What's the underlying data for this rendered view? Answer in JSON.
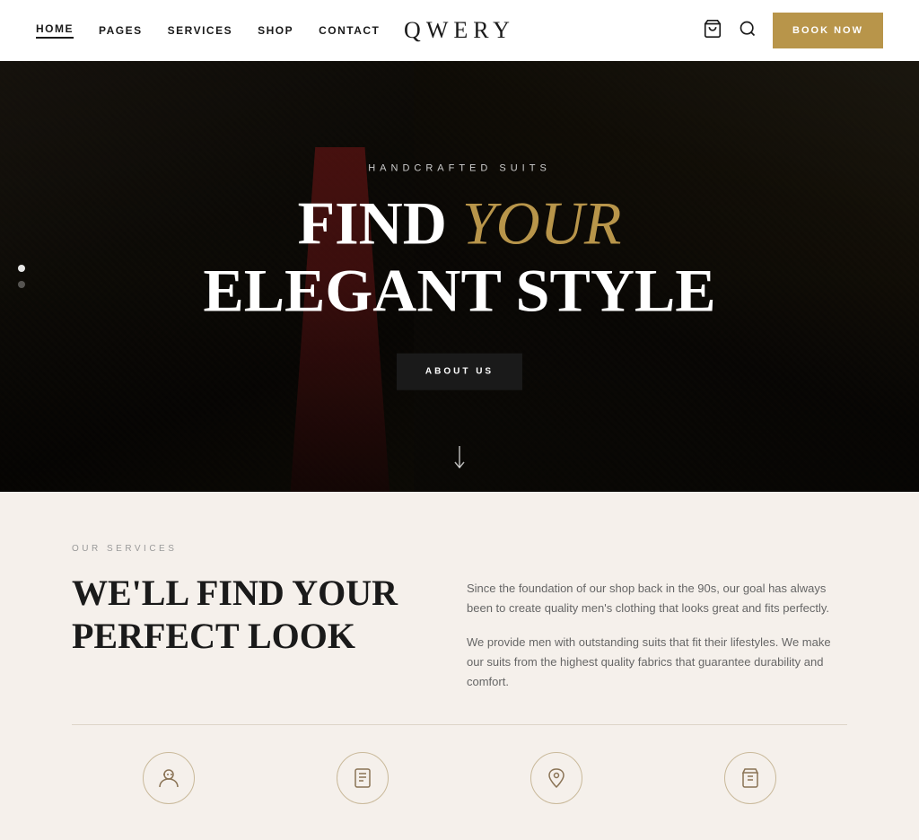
{
  "brand": "QWERY",
  "nav": {
    "items": [
      {
        "label": "HOME",
        "active": true
      },
      {
        "label": "PAGES",
        "active": false
      },
      {
        "label": "SERVICES",
        "active": false
      },
      {
        "label": "SHOP",
        "active": false
      },
      {
        "label": "CONTACT",
        "active": false
      }
    ]
  },
  "buttons": {
    "book_now": "BOOK NOW",
    "about_us": "ABOUT US"
  },
  "hero": {
    "subtitle": "HANDCRAFTED SUITS",
    "title_line1_normal": "FIND ",
    "title_line1_italic": "YOUR",
    "title_line2": "ELEGANT STYLE",
    "scroll_icon": "↓"
  },
  "services": {
    "label": "OUR SERVICES",
    "heading_line1": "WE'LL FIND YOUR",
    "heading_line2": "PERFECT LOOK",
    "para1": "Since the foundation of our shop back in the 90s, our goal has always been to create quality men's clothing that looks great and fits perfectly.",
    "para2": "We provide men with outstanding suits that fit their lifestyles. We make our suits from the highest quality fabrics that guarantee durability and comfort.",
    "icons": [
      {
        "id": "icon1"
      },
      {
        "id": "icon2"
      },
      {
        "id": "icon3"
      },
      {
        "id": "icon4"
      }
    ]
  },
  "icons": {
    "cart": "🛍",
    "search": "🔍"
  }
}
